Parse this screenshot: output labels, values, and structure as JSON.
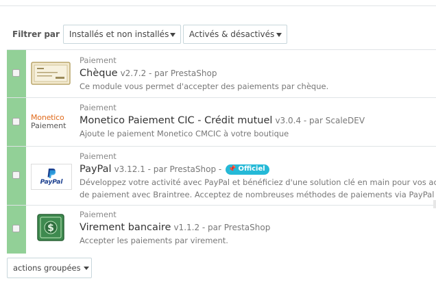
{
  "filters": {
    "label": "Filtrer par",
    "install_select": "Installés et non installés",
    "status_select": "Activés & désactivés"
  },
  "modules": [
    {
      "category": "Paiement",
      "name": "Chèque",
      "meta": "v2.7.2 - par PrestaShop",
      "description": "Ce module vous permet d'accepter des paiements par chèque.",
      "logo_icon": "check-document-icon"
    },
    {
      "category": "Paiement",
      "name": "Monetico Paiement CIC - Crédit mutuel",
      "meta": "v3.0.4 - par ScaleDEV",
      "description": "Ajoute le paiement Monetico CMCIC à votre boutique",
      "logo_text_1": "Monetico",
      "logo_text_2": "Paiement"
    },
    {
      "category": "Paiement",
      "name": "PayPal",
      "meta": "v3.12.1 - par PrestaShop -",
      "badge": "Officiel",
      "description_line1": "Développez votre activité avec PayPal et bénéficiez d'une solution clé en main pour vos activ",
      "description_line2": "de paiement avec Braintree. Acceptez de nombreuses méthodes de paiements via PayPal et B",
      "logo_text": "PayPal"
    },
    {
      "category": "Paiement",
      "name": "Virement bancaire",
      "meta": "v1.1.2 - par PrestaShop",
      "description": "Accepter les paiements par virement.",
      "logo_icon": "dollar-bill-icon"
    }
  ],
  "bulk_actions_label": "actions groupées",
  "colors": {
    "enabled_status": "#92d097",
    "badge": "#25b9d7"
  }
}
